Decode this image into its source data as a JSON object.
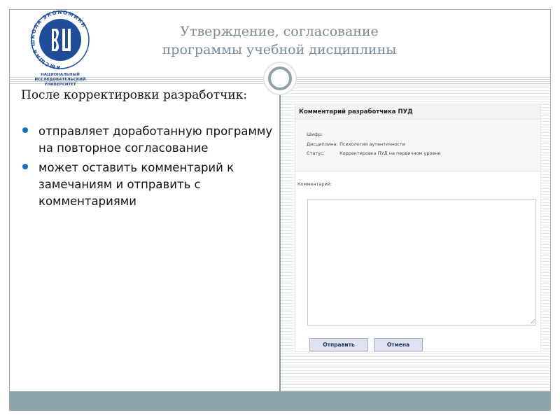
{
  "header": {
    "title_line1": "Утверждение, согласование",
    "title_line2": "программы учебной дисциплины"
  },
  "logo": {
    "monogram": "ВШЭ",
    "ring_text": "ВЫСШАЯ ШКОЛА ЭКОНОМИКИ",
    "caption_line1": "НАЦИОНАЛЬНЫЙ ИССЛЕДОВАТЕЛЬСКИЙ",
    "caption_line2": "УНИВЕРСИТЕТ",
    "color": "#1f4d9a"
  },
  "content": {
    "intro": "После корректировки разработчик:",
    "bullets": [
      "отправляет  доработанную программу на повторное согласование",
      "может оставить комментарий к замечаниям и отправить с комментариями"
    ]
  },
  "form": {
    "title": "Комментарий разработчика ПУД",
    "fields": [
      {
        "label": "Шифр:",
        "value": ""
      },
      {
        "label": "Дисциплина:",
        "value": "Психология аутентичности"
      },
      {
        "label": "Статус:",
        "value": "Корректировка ПУД на первичном уровне"
      }
    ],
    "comment_label": "Комментарий:",
    "comment_value": "",
    "send_label": "Отправить",
    "cancel_label": "Отмена"
  },
  "colors": {
    "accent": "#8ea3a7",
    "title": "#7a8b95",
    "bullet": "#1a6fb3"
  }
}
